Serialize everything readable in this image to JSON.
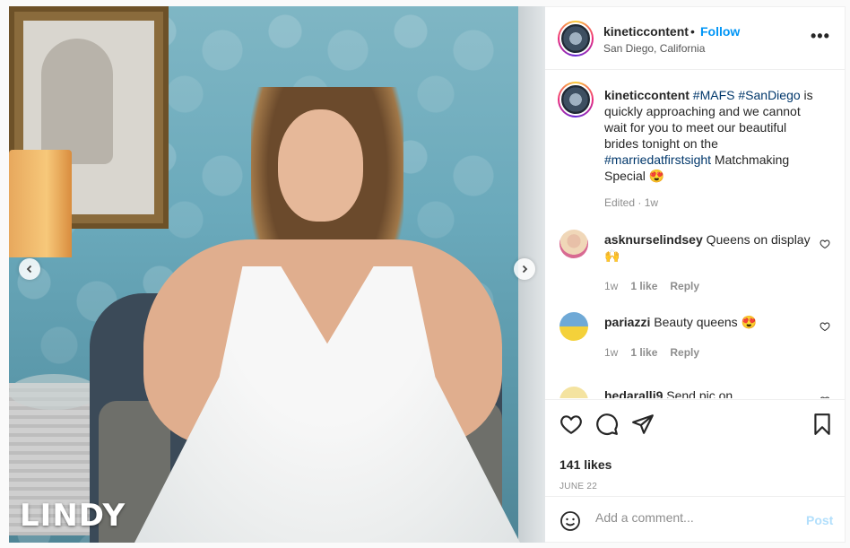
{
  "media": {
    "overlay_name": "LINDY",
    "prev_icon": "chevron-left-icon",
    "next_icon": "chevron-right-icon"
  },
  "header": {
    "username": "kineticcontent",
    "separator": "•",
    "follow_label": "Follow",
    "location": "San Diego, California",
    "more_label": "•••"
  },
  "caption": {
    "username": "kineticcontent",
    "tag1": "#MAFS",
    "tag2": "#SanDiego",
    "text1": " is quickly approaching and we cannot wait for you to meet our beautiful brides tonight on the ",
    "tag3": "#marriedatfirstsight",
    "text2": " Matchmaking Special 😍",
    "meta": "Edited · 1w"
  },
  "comments": [
    {
      "username": "asknurselindsey",
      "text": "Queens on display 🙌",
      "age": "1w",
      "likes": "1 like",
      "reply": "Reply"
    },
    {
      "username": "pariazzi",
      "text": "Beauty queens 😍",
      "age": "1w",
      "likes": "1 like",
      "reply": "Reply"
    },
    {
      "username": "hedaralli9",
      "text": "Send pic on",
      "age": "",
      "likes": "",
      "reply": ""
    }
  ],
  "actions": {
    "likes": "141 likes",
    "date": "JUNE 22"
  },
  "add_comment": {
    "placeholder": "Add a comment...",
    "post_label": "Post"
  },
  "colors": {
    "accent": "#0095f6",
    "post_disabled": "#b2dffc",
    "hashtag": "#00376b",
    "muted": "#8e8e8e"
  }
}
